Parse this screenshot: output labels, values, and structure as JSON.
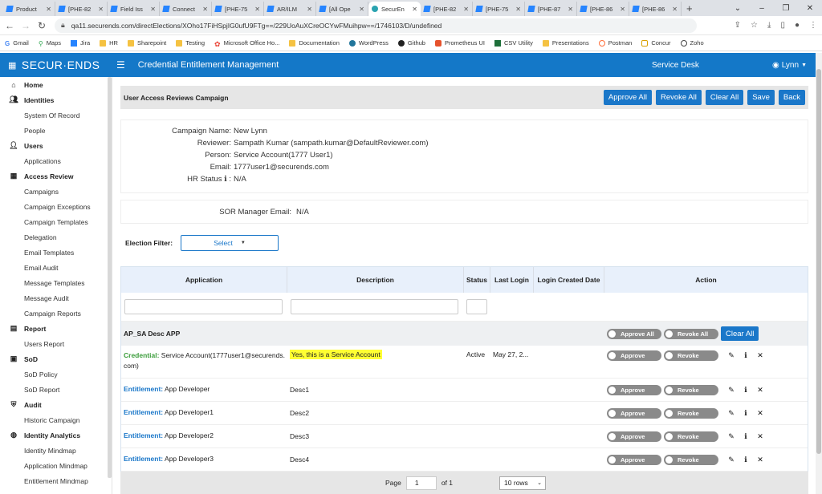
{
  "browser": {
    "tabs": [
      {
        "label": "Product",
        "icon": "jira"
      },
      {
        "label": "[PHE-82",
        "icon": "jira"
      },
      {
        "label": "Field Iss",
        "icon": "jira"
      },
      {
        "label": "Connect",
        "icon": "jira"
      },
      {
        "label": "[PHE-75",
        "icon": "jira"
      },
      {
        "label": "AR/ILM",
        "icon": "jira"
      },
      {
        "label": "[All Ope",
        "icon": "jira"
      },
      {
        "label": "SecurEn",
        "icon": "securends"
      },
      {
        "label": "[PHE-82",
        "icon": "jira"
      },
      {
        "label": "[PHE-75",
        "icon": "jira"
      },
      {
        "label": "[PHE-87",
        "icon": "jira"
      },
      {
        "label": "[PHE-86",
        "icon": "jira"
      },
      {
        "label": "[PHE-86",
        "icon": "jira"
      }
    ],
    "url": "qa11.securends.com/directElections/XOho17FiHSpjIG0ufU9FTg==/229UoAuXCreOCYwFMuihpw==/1746103/D/undefined",
    "bookmarks": [
      "Gmail",
      "Maps",
      "Jira",
      "HR",
      "Sharepoint",
      "Testing",
      "Microsoft Office Ho...",
      "Documentation",
      "WordPress",
      "Github",
      "Prometheus UI",
      "CSV Utility",
      "Presentations",
      "Postman",
      "Concur",
      "Zoho"
    ]
  },
  "app": {
    "logo": "SECUR·ENDS",
    "title": "Credential Entitlement Management",
    "service_desk": "Service Desk",
    "user": "Lynn",
    "brand_color": "#1478c8"
  },
  "sidebar": [
    {
      "label": "Home",
      "type": "main",
      "icon": "home-icon"
    },
    {
      "label": "Identities",
      "type": "main",
      "icon": "users-icon"
    },
    {
      "label": "System Of Record",
      "type": "sub"
    },
    {
      "label": "People",
      "type": "sub"
    },
    {
      "label": "Users",
      "type": "main",
      "icon": "user-icon"
    },
    {
      "label": "Applications",
      "type": "sub"
    },
    {
      "label": "Access Review",
      "type": "main",
      "icon": "grid-icon"
    },
    {
      "label": "Campaigns",
      "type": "sub"
    },
    {
      "label": "Campaign Exceptions",
      "type": "sub"
    },
    {
      "label": "Campaign Templates",
      "type": "sub"
    },
    {
      "label": "Delegation",
      "type": "sub"
    },
    {
      "label": "Email Templates",
      "type": "sub"
    },
    {
      "label": "Email Audit",
      "type": "sub"
    },
    {
      "label": "Message Templates",
      "type": "sub"
    },
    {
      "label": "Message Audit",
      "type": "sub"
    },
    {
      "label": "Campaign Reports",
      "type": "sub"
    },
    {
      "label": "Report",
      "type": "main",
      "icon": "file-icon"
    },
    {
      "label": "Users Report",
      "type": "sub"
    },
    {
      "label": "SoD",
      "type": "main",
      "icon": "table-icon"
    },
    {
      "label": "SoD Policy",
      "type": "sub"
    },
    {
      "label": "SoD Report",
      "type": "sub"
    },
    {
      "label": "Audit",
      "type": "main",
      "icon": "shield-icon"
    },
    {
      "label": "Historic Campaign",
      "type": "sub"
    },
    {
      "label": "Identity Analytics",
      "type": "main",
      "icon": "analytics-icon"
    },
    {
      "label": "Identity Mindmap",
      "type": "sub"
    },
    {
      "label": "Application Mindmap",
      "type": "sub"
    },
    {
      "label": "Entitlement Mindmap",
      "type": "sub"
    }
  ],
  "page": {
    "heading": "User Access Reviews Campaign",
    "buttons": [
      "Approve All",
      "Revoke All",
      "Clear All",
      "Save",
      "Back"
    ],
    "info": [
      {
        "label": "Campaign Name:",
        "value": "New Lynn"
      },
      {
        "label": "Reviewer:",
        "value": "Sampath Kumar (sampath.kumar@DefaultReviewer.com)"
      },
      {
        "label": "Person:",
        "value": "Service Account(1777 User1)"
      },
      {
        "label": "Email:",
        "value": "1777user1@securends.com"
      },
      {
        "label": "HR Status",
        "value": "N/A"
      }
    ],
    "sor_label": "SOR Manager Email:",
    "sor_value": "N/A",
    "filter_label": "Election Filter:",
    "filter_value": "Select"
  },
  "table": {
    "headers": [
      "Application",
      "Description",
      "Status",
      "Last Login",
      "Login Created Date",
      "Action"
    ],
    "group": {
      "name": "AP_SA Desc APP",
      "approve_all": "Approve All",
      "revoke_all": "Revoke All",
      "clear_all": "Clear All"
    },
    "rows": [
      {
        "prefix": "Credential:",
        "name": "Service Account(1777user1@securends.com)",
        "desc": "Yes, this is a Service Account",
        "status": "Active",
        "last_login": "May 27, 2...",
        "kind": "credential"
      },
      {
        "prefix": "Entitlement:",
        "name": "App Developer",
        "desc": "Desc1",
        "status": "",
        "last_login": "",
        "kind": "entitlement"
      },
      {
        "prefix": "Entitlement:",
        "name": "App Developer1",
        "desc": "Desc2",
        "status": "",
        "last_login": "",
        "kind": "entitlement"
      },
      {
        "prefix": "Entitlement:",
        "name": "App Developer2",
        "desc": "Desc3",
        "status": "",
        "last_login": "",
        "kind": "entitlement"
      },
      {
        "prefix": "Entitlement:",
        "name": "App Developer3",
        "desc": "Desc4",
        "status": "",
        "last_login": "",
        "kind": "entitlement"
      }
    ],
    "approve_label": "Approve",
    "revoke_label": "Revoke"
  },
  "pager": {
    "page_label": "Page",
    "page": "1",
    "of": "of 1",
    "rows": "10 rows"
  }
}
